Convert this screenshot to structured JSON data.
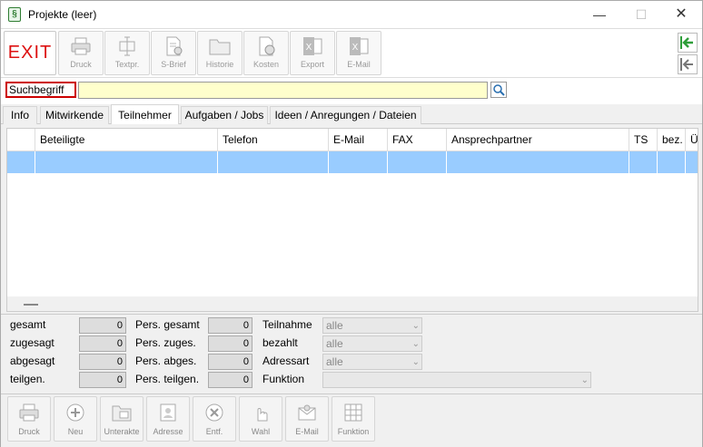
{
  "window": {
    "title": "Projekte (leer)",
    "app_icon_glyph": "§"
  },
  "toolbar": {
    "exit_label": "EXIT",
    "buttons": [
      {
        "label": "Druck",
        "icon": "printer-icon"
      },
      {
        "label": "Textpr.",
        "icon": "text-processing-icon"
      },
      {
        "label": "S-Brief",
        "icon": "letter-gear-icon"
      },
      {
        "label": "Historie",
        "icon": "folder-icon"
      },
      {
        "label": "Kosten",
        "icon": "document-coin-icon"
      },
      {
        "label": "Export",
        "icon": "excel-icon"
      },
      {
        "label": "E-Mail",
        "icon": "excel-mail-icon"
      }
    ]
  },
  "search": {
    "label": "Suchbegriff",
    "value": ""
  },
  "tabs": [
    {
      "label": "Info"
    },
    {
      "label": "Mitwirkende"
    },
    {
      "label": "Teilnehmer",
      "active": true
    },
    {
      "label": "Aufgaben / Jobs"
    },
    {
      "label": "Ideen / Anregungen / Dateien"
    }
  ],
  "grid": {
    "columns": [
      "",
      "Beteiligte",
      "Telefon",
      "E-Mail",
      "FAX",
      "Ansprechpartner",
      "TS",
      "bez.",
      "Ü"
    ]
  },
  "summary": {
    "counts": [
      {
        "label": "gesamt",
        "value": "0"
      },
      {
        "label": "zugesagt",
        "value": "0"
      },
      {
        "label": "abgesagt",
        "value": "0"
      },
      {
        "label": "teilgen.",
        "value": "0"
      }
    ],
    "persons": [
      {
        "label": "Pers. gesamt",
        "value": "0"
      },
      {
        "label": "Pers. zuges.",
        "value": "0"
      },
      {
        "label": "Pers. abges.",
        "value": "0"
      },
      {
        "label": "Pers. teilgen.",
        "value": "0"
      }
    ],
    "filters": [
      {
        "label": "Teilnahme",
        "value": "alle"
      },
      {
        "label": "bezahlt",
        "value": "alle"
      },
      {
        "label": "Adressart",
        "value": "alle"
      },
      {
        "label": "Funktion",
        "value": ""
      }
    ]
  },
  "bottombar": {
    "buttons": [
      {
        "label": "Druck",
        "icon": "printer-icon"
      },
      {
        "label": "Neu",
        "icon": "plus-icon"
      },
      {
        "label": "Unterakte",
        "icon": "subfolder-icon"
      },
      {
        "label": "Adresse",
        "icon": "address-book-icon"
      },
      {
        "label": "Entf.",
        "icon": "delete-icon"
      },
      {
        "label": "Wahl",
        "icon": "hand-pointer-icon"
      },
      {
        "label": "E-Mail",
        "icon": "mail-icon"
      },
      {
        "label": "Funktion",
        "icon": "grid-icon"
      }
    ]
  },
  "colors": {
    "selection": "#99ccff",
    "search_bg": "#ffffcc",
    "exit": "#dd1111",
    "accent_green": "#2f9e3a"
  }
}
